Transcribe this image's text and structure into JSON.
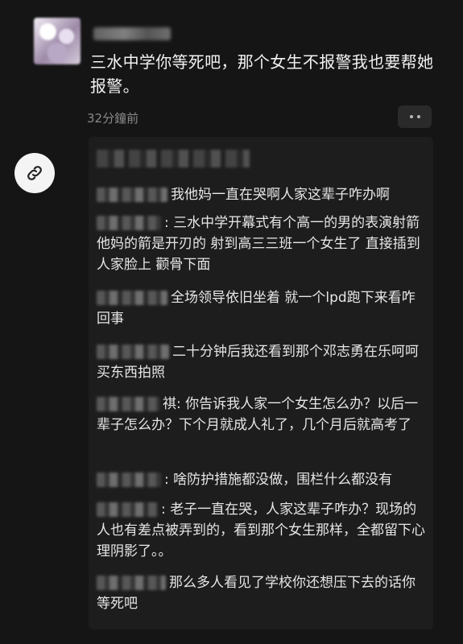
{
  "post": {
    "text": "三水中学你等死吧，那个女生不报警我也要帮她报警。",
    "timestamp": "32分鐘前"
  },
  "icons": {
    "more": "more-icon",
    "link": "link-icon"
  },
  "comments": [
    {
      "text": "我他妈一直在哭啊人家这辈子咋办啊"
    },
    {
      "text": ": 三水中学开幕式有个高一的男的表演射箭 他妈的箭是开刃的 射到高三三班一个女生了 直接插到人家脸上 颧骨下面"
    },
    {
      "text": "全场领导依旧坐着 就一个lpd跑下来看咋回事"
    },
    {
      "text": "二十分钟后我还看到那个邓志勇在乐呵呵买东西拍照"
    },
    {
      "text": "祺: 你告诉我人家一个女生怎么办？以后一辈子怎么办？下个月就成人礼了，几个月后就高考了"
    },
    {
      "text": ": 啥防护措施都没做，围栏什么都没有"
    },
    {
      "text": ": 老子一直在哭，人家这辈子咋办？现场的人也有差点被弄到的，看到那个女生那样，全都留下心理阴影了。。"
    },
    {
      "text": "那么多人看见了学校你还想压下去的话你等死吧"
    }
  ]
}
